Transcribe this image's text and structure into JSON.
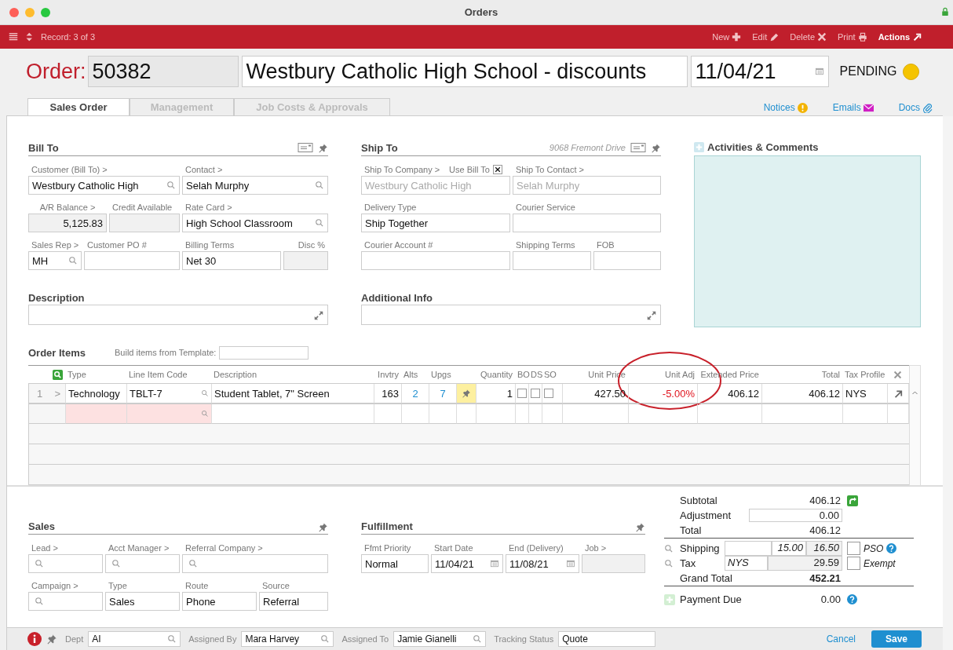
{
  "window": {
    "title": "Orders"
  },
  "toolbar": {
    "record": "Record: 3 of 3",
    "actions": [
      {
        "label": "New",
        "kind": "new"
      },
      {
        "label": "Edit",
        "kind": "edit"
      },
      {
        "label": "Delete",
        "kind": "delete"
      },
      {
        "label": "Print",
        "kind": "print"
      },
      {
        "label": "Actions",
        "kind": "actions"
      }
    ]
  },
  "header": {
    "label": "Order:",
    "number": "50382",
    "title": "Westbury Catholic High School - discounts",
    "date": "11/04/21",
    "status": "PENDING"
  },
  "tabs": [
    {
      "label": "Sales Order",
      "selected": true
    },
    {
      "label": "Management",
      "selected": false
    },
    {
      "label": "Job Costs & Approvals",
      "selected": false
    }
  ],
  "links": [
    {
      "label": "Notices",
      "kind": "notices"
    },
    {
      "label": "Emails",
      "kind": "emails"
    },
    {
      "label": "Docs",
      "kind": "docs"
    }
  ],
  "bill_to": {
    "title": "Bill To",
    "panes": [
      {
        "rows": [
          [
            {
              "label": "Customer (Bill To) >",
              "value": "Westbury Catholic High",
              "kind": "lookup"
            }
          ],
          [
            {
              "label": "A/R Balance >",
              "value": "5,125.83",
              "kind": "amount"
            },
            {
              "label": "Credit Available",
              "kind": "readonly"
            }
          ],
          [
            {
              "label": "Sales Rep >",
              "value": "MH",
              "kind": "lookup"
            },
            {
              "label": "Customer PO #",
              "kind": "text"
            }
          ]
        ]
      },
      {
        "rows": [
          [
            {
              "label": "Contact >",
              "value": "Selah Murphy",
              "kind": "lookup"
            }
          ],
          [
            {
              "label": "Rate Card >",
              "value": "High School Classroom",
              "kind": "lookup"
            }
          ],
          [
            {
              "label": "Billing Terms",
              "value": "Net 30",
              "kind": "text"
            },
            {
              "label": "Disc %",
              "kind": "percent"
            }
          ]
        ]
      }
    ]
  },
  "ship_to": {
    "title": "Ship To",
    "address": "9068 Fremont Drive",
    "rows": [
      [
        {
          "label": "Ship To Company >",
          "value": "Westbury Catholic High",
          "kind": "disabled",
          "option": {
            "label": "Use Bill To",
            "checked": true
          }
        },
        {
          "label": "Ship To Contact >",
          "value": "Selah Murphy",
          "kind": "disabled"
        }
      ],
      [
        {
          "label": "Delivery Type",
          "value": "Ship Together",
          "kind": "text"
        },
        {
          "label": "Courier Service",
          "kind": "text"
        }
      ],
      [
        {
          "label": "Courier Account #",
          "kind": "text"
        },
        {
          "label": "Shipping Terms",
          "kind": "text"
        },
        {
          "label": "FOB",
          "kind": "text"
        }
      ]
    ]
  },
  "description": {
    "title": "Description"
  },
  "additional_info": {
    "title": "Additional Info"
  },
  "activities": {
    "title": "Activities & Comments"
  },
  "order_items": {
    "title": "Order Items",
    "template_label": "Build items from Template:",
    "columns": [
      {
        "kind": "index",
        "circled": false
      },
      {
        "label": "Type",
        "kind": "text",
        "circled": false
      },
      {
        "label": "Line Item Code",
        "kind": "lookup",
        "circled": false
      },
      {
        "label": "Description",
        "kind": "text",
        "circled": false
      },
      {
        "label": "Invtry",
        "kind": "number",
        "circled": false
      },
      {
        "label": "Alts",
        "kind": "link",
        "circled": false
      },
      {
        "label": "Upgs",
        "kind": "link",
        "circled": false
      },
      {
        "kind": "pin",
        "circled": false
      },
      {
        "label": "Quantity",
        "kind": "number",
        "circled": false
      },
      {
        "label": "BO",
        "kind": "check",
        "circled": false
      },
      {
        "label": "DS",
        "kind": "check",
        "circled": false
      },
      {
        "label": "SO",
        "kind": "check",
        "circled": false
      },
      {
        "label": "Unit Price",
        "kind": "number",
        "circled": false
      },
      {
        "label": "Unit Adj",
        "kind": "adjust",
        "circled": true
      },
      {
        "label": "Extended Price",
        "kind": "number",
        "circled": false
      },
      {
        "label": "Total",
        "kind": "number",
        "circled": false
      },
      {
        "label": "Tax Profile",
        "kind": "text",
        "circled": false
      },
      {
        "kind": "remove",
        "circled": false
      }
    ],
    "rows": [
      {
        "number": "1",
        "expander": ">",
        "blank": false,
        "cells": [
          "Technology",
          "TBLT-7",
          "Student Tablet, 7\" Screen",
          "163",
          "2",
          "7",
          "1",
          false,
          false,
          false,
          "427.50",
          "-5.00%",
          "406.12",
          "406.12",
          "NYS"
        ]
      },
      {
        "blank": true
      }
    ]
  },
  "sales": {
    "title": "Sales",
    "rows": [
      [
        {
          "label": "Lead >",
          "kind": "lookup"
        },
        {
          "label": "Acct Manager >",
          "kind": "lookup"
        },
        {
          "label": "Referral Company >",
          "kind": "lookup"
        }
      ],
      [
        {
          "label": "Campaign >",
          "kind": "lookup"
        },
        {
          "label": "Type",
          "value": "Sales",
          "kind": "text"
        },
        {
          "label": "Route",
          "value": "Phone",
          "kind": "text"
        },
        {
          "label": "Source",
          "value": "Referral",
          "kind": "text"
        }
      ]
    ]
  },
  "fulfillment": {
    "title": "Fulfillment",
    "rows": [
      [
        {
          "label": "Ffmt Priority",
          "value": "Normal",
          "kind": "text"
        },
        {
          "label": "Start Date",
          "value": "11/04/21",
          "kind": "date"
        },
        {
          "label": "End (Delivery)",
          "value": "11/08/21",
          "kind": "date"
        },
        {
          "label": "Job >",
          "kind": "readonly"
        }
      ]
    ]
  },
  "totals": [
    {
      "label": "Subtotal",
      "value": "406.12",
      "kind": "subtotal"
    },
    {
      "label": "Adjustment",
      "value": "0.00",
      "kind": "input"
    },
    {
      "label": "Total",
      "value": "406.12",
      "kind": "total"
    },
    {
      "label": "Shipping",
      "kind": "shipping",
      "values": [
        "15.00",
        "16.50"
      ],
      "option": {
        "label": "PSO",
        "checked": false
      }
    },
    {
      "label": "Tax",
      "kind": "tax",
      "profile": "NYS",
      "value": "29.59",
      "option": {
        "label": "Exempt",
        "checked": false
      }
    },
    {
      "label": "Grand Total",
      "value": "452.21",
      "kind": "grand"
    },
    {
      "label": "Payment Due",
      "value": "0.00",
      "kind": "due"
    }
  ],
  "footer": {
    "fields": [
      {
        "label": "Dept",
        "value": "AI",
        "kind": "lookup"
      },
      {
        "label": "Assigned By",
        "value": "Mara Harvey",
        "kind": "lookup"
      },
      {
        "label": "Assigned To",
        "value": "Jamie Gianelli",
        "kind": "lookup"
      },
      {
        "label": "Tracking Status",
        "value": "Quote",
        "kind": "text"
      }
    ],
    "cancel": "Cancel",
    "save": "Save"
  }
}
